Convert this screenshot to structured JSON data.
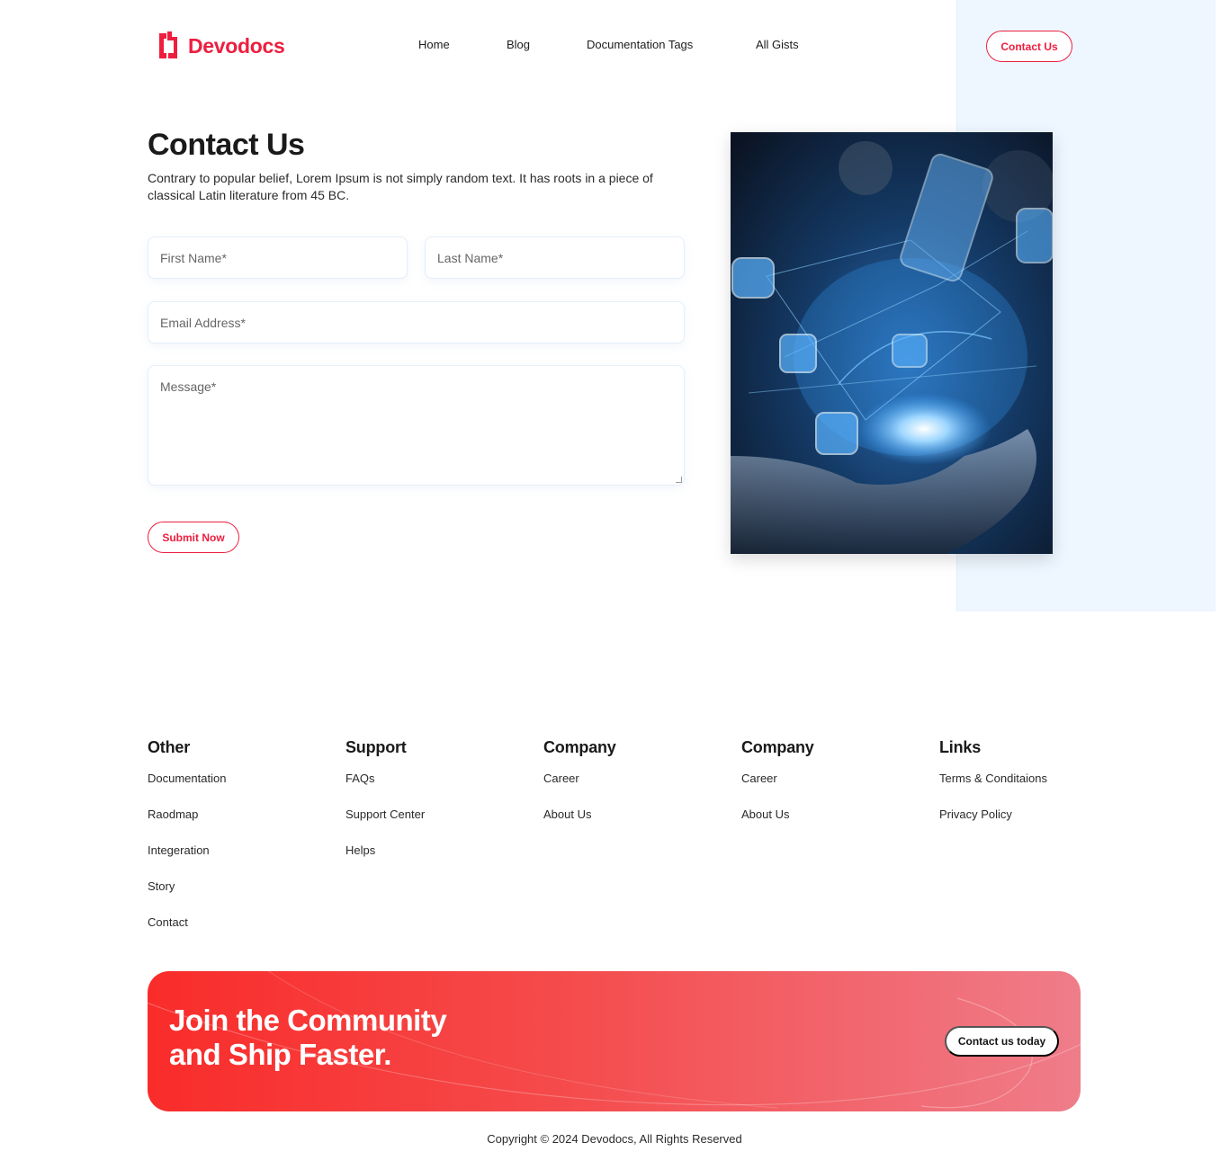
{
  "brand": {
    "name": "Devodocs",
    "accent": "#ee1e3f"
  },
  "nav": {
    "items": [
      "Home",
      "Blog",
      "Documentation Tags",
      "All Gists"
    ],
    "cta_label": "Contact Us"
  },
  "contact": {
    "title": "Contact Us",
    "description": "Contrary to popular belief, Lorem Ipsum is not simply random text. It has roots in a piece of classical Latin literature from 45 BC.",
    "fields": {
      "first_name_placeholder": "First Name*",
      "last_name_placeholder": "Last Name*",
      "email_placeholder": "Email Address*",
      "message_placeholder": "Message*"
    },
    "submit_label": "Submit Now"
  },
  "footer": {
    "columns": [
      {
        "heading": "Other",
        "links": [
          "Documentation",
          "Raodmap",
          "Integeration",
          "Story",
          "Contact"
        ]
      },
      {
        "heading": "Support",
        "links": [
          "FAQs",
          "Support Center",
          "Helps"
        ]
      },
      {
        "heading": "Company",
        "links": [
          "Career",
          "About Us"
        ]
      },
      {
        "heading": "Company",
        "links": [
          "Career",
          "About Us"
        ]
      },
      {
        "heading": "Links",
        "links": [
          "Terms & Conditaions",
          "Privacy Policy"
        ]
      }
    ],
    "banner": {
      "line1": "Join the Community",
      "line2": "and Ship Faster.",
      "cta_label": "Contact us today"
    },
    "copyright": "Copyright © 2024 Devodocs, All Rights Reserved"
  }
}
